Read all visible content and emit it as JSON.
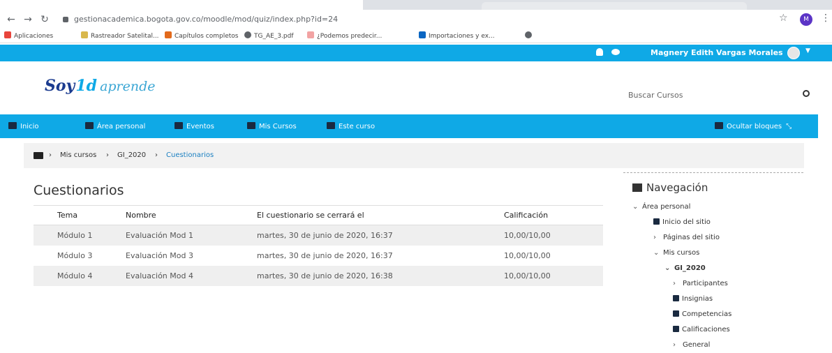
{
  "browser": {
    "url": "gestionacademica.bogota.gov.co/moodle/mod/quiz/index.php?id=24",
    "profile_initial": "M",
    "bookmarks": [
      {
        "label": "Aplicaciones",
        "color": "#e8453c"
      },
      {
        "label": "Rastreador Satelital...",
        "color": "#d9b84c"
      },
      {
        "label": "Capítulos completos",
        "color": "#e26a1c"
      },
      {
        "label": "TG_AE_3.pdf",
        "color": "#5f6368"
      },
      {
        "label": "¿Podemos predecir...",
        "color": "#f2a3a3"
      },
      {
        "label": "Importaciones y ex...",
        "color": "#0a66c2"
      },
      {
        "label": "",
        "color": "#5f6368"
      }
    ]
  },
  "topbar": {
    "user_name": "Magnery Edith Vargas Morales",
    "accent": "#0fa9e6"
  },
  "header": {
    "logo_soy": "Soy",
    "logo_id": "1d",
    "logo_aprende": "aprende",
    "search_placeholder": "Buscar Cursos"
  },
  "navbar": {
    "items": [
      "Inicio",
      "Área personal",
      "Eventos",
      "Mis Cursos",
      "Este curso"
    ],
    "hide_blocks": "Ocultar bloques"
  },
  "breadcrumb": [
    "Mis cursos",
    "GI_2020",
    "Cuestionarios"
  ],
  "main": {
    "title": "Cuestionarios",
    "columns": [
      "Tema",
      "Nombre",
      "El cuestionario se cerrará el",
      "Calificación"
    ],
    "rows": [
      [
        "Módulo 1",
        "Evaluación Mod 1",
        "martes, 30 de junio de 2020, 16:37",
        "10,00/10,00"
      ],
      [
        "Módulo 3",
        "Evaluación Mod 3",
        "martes, 30 de junio de 2020, 16:37",
        "10,00/10,00"
      ],
      [
        "Módulo 4",
        "Evaluación Mod 4",
        "martes, 30 de junio de 2020, 16:38",
        "10,00/10,00"
      ]
    ]
  },
  "sidebar": {
    "title": "Navegación",
    "items": [
      {
        "label": "Área personal",
        "marker": "⌄",
        "icon": "chevron-down-icon"
      },
      {
        "label": "Inicio del sitio",
        "marker": "",
        "icon": "home-icon"
      },
      {
        "label": "Páginas del sitio",
        "marker": "›",
        "icon": "chevron-right-icon"
      },
      {
        "label": "Mis cursos",
        "marker": "⌄",
        "icon": "chevron-down-icon"
      },
      {
        "label": "GI_2020",
        "marker": "⌄",
        "icon": "chevron-down-icon"
      },
      {
        "label": "Participantes",
        "marker": "›",
        "icon": "chevron-right-icon"
      },
      {
        "label": "Insignias",
        "marker": "",
        "icon": "shield-icon"
      },
      {
        "label": "Competencias",
        "marker": "",
        "icon": "checkbox-icon"
      },
      {
        "label": "Calificaciones",
        "marker": "",
        "icon": "table-icon"
      },
      {
        "label": "General",
        "marker": "›",
        "icon": "chevron-right-icon"
      }
    ]
  }
}
